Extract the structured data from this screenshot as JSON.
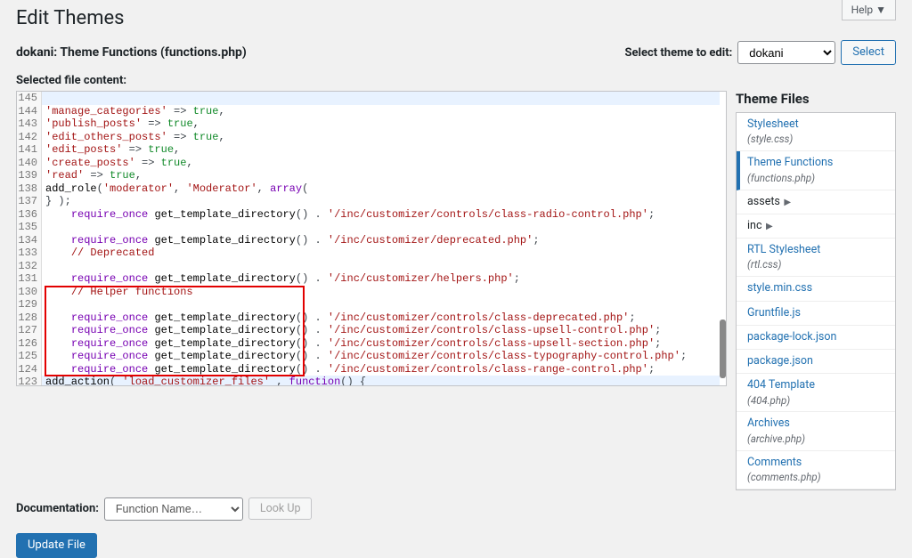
{
  "help_tab": "Help ▼",
  "page_title": "Edit Themes",
  "file_heading": "dokani: Theme Functions (functions.php)",
  "theme_select": {
    "label": "Select theme to edit:",
    "value": "dokani",
    "button": "Select"
  },
  "selected_file_label": "Selected file content:",
  "code_lines": [
    {
      "n": 123,
      "hl": true,
      "tokens": [
        [
          "id",
          "add_action"
        ],
        [
          "",
          "( "
        ],
        [
          "str",
          "'load_customizer_files'"
        ],
        [
          "",
          " , "
        ],
        [
          "kw",
          "function"
        ],
        [
          "",
          "() {"
        ]
      ]
    },
    {
      "n": 124,
      "hl": false,
      "tokens": [
        [
          "",
          "    "
        ],
        [
          "kw",
          "require_once"
        ],
        [
          "",
          " "
        ],
        [
          "id",
          "get_template_directory"
        ],
        [
          "",
          "() . "
        ],
        [
          "str",
          "'/inc/customizer/controls/class-range-control.php'"
        ],
        [
          "",
          ";"
        ]
      ]
    },
    {
      "n": 125,
      "hl": false,
      "tokens": [
        [
          "",
          "    "
        ],
        [
          "kw",
          "require_once"
        ],
        [
          "",
          " "
        ],
        [
          "id",
          "get_template_directory"
        ],
        [
          "",
          "() . "
        ],
        [
          "str",
          "'/inc/customizer/controls/class-typography-control.php'"
        ],
        [
          "",
          ";"
        ]
      ]
    },
    {
      "n": 126,
      "hl": false,
      "tokens": [
        [
          "",
          "    "
        ],
        [
          "kw",
          "require_once"
        ],
        [
          "",
          " "
        ],
        [
          "id",
          "get_template_directory"
        ],
        [
          "",
          "() . "
        ],
        [
          "str",
          "'/inc/customizer/controls/class-upsell-section.php'"
        ],
        [
          "",
          ";"
        ]
      ]
    },
    {
      "n": 127,
      "hl": false,
      "tokens": [
        [
          "",
          "    "
        ],
        [
          "kw",
          "require_once"
        ],
        [
          "",
          " "
        ],
        [
          "id",
          "get_template_directory"
        ],
        [
          "",
          "() . "
        ],
        [
          "str",
          "'/inc/customizer/controls/class-upsell-control.php'"
        ],
        [
          "",
          ";"
        ]
      ]
    },
    {
      "n": 128,
      "hl": false,
      "tokens": [
        [
          "",
          "    "
        ],
        [
          "kw",
          "require_once"
        ],
        [
          "",
          " "
        ],
        [
          "id",
          "get_template_directory"
        ],
        [
          "",
          "() . "
        ],
        [
          "str",
          "'/inc/customizer/controls/class-deprecated.php'"
        ],
        [
          "",
          ";"
        ]
      ]
    },
    {
      "n": 129,
      "hl": false,
      "tokens": [
        [
          "",
          ""
        ]
      ]
    },
    {
      "n": 130,
      "hl": false,
      "tokens": [
        [
          "",
          "    "
        ],
        [
          "str",
          "// Helper functions"
        ]
      ]
    },
    {
      "n": 131,
      "hl": false,
      "tokens": [
        [
          "",
          "    "
        ],
        [
          "kw",
          "require_once"
        ],
        [
          "",
          " "
        ],
        [
          "id",
          "get_template_directory"
        ],
        [
          "",
          "() . "
        ],
        [
          "str",
          "'/inc/customizer/helpers.php'"
        ],
        [
          "",
          ";"
        ]
      ]
    },
    {
      "n": 132,
      "hl": false,
      "tokens": [
        [
          "",
          ""
        ]
      ]
    },
    {
      "n": 133,
      "hl": false,
      "tokens": [
        [
          "",
          "    "
        ],
        [
          "str",
          "// Deprecated"
        ]
      ]
    },
    {
      "n": 134,
      "hl": false,
      "tokens": [
        [
          "",
          "    "
        ],
        [
          "kw",
          "require_once"
        ],
        [
          "",
          " "
        ],
        [
          "id",
          "get_template_directory"
        ],
        [
          "",
          "() . "
        ],
        [
          "str",
          "'/inc/customizer/deprecated.php'"
        ],
        [
          "",
          ";"
        ]
      ]
    },
    {
      "n": 135,
      "hl": false,
      "tokens": [
        [
          "",
          ""
        ]
      ]
    },
    {
      "n": 136,
      "hl": false,
      "tokens": [
        [
          "",
          "    "
        ],
        [
          "kw",
          "require_once"
        ],
        [
          "",
          " "
        ],
        [
          "id",
          "get_template_directory"
        ],
        [
          "",
          "() . "
        ],
        [
          "str",
          "'/inc/customizer/controls/class-radio-control.php'"
        ],
        [
          "",
          ";"
        ]
      ]
    },
    {
      "n": 137,
      "hl": false,
      "tokens": [
        [
          "",
          "} );"
        ]
      ]
    },
    {
      "n": 138,
      "hl": false,
      "tokens": [
        [
          "id",
          "add_role"
        ],
        [
          "",
          "("
        ],
        [
          "str",
          "'moderator'"
        ],
        [
          "",
          ", "
        ],
        [
          "str",
          "'Moderator'"
        ],
        [
          "",
          ", "
        ],
        [
          "kw",
          "array"
        ],
        [
          "",
          "("
        ]
      ]
    },
    {
      "n": 139,
      "hl": false,
      "tokens": [
        [
          "str",
          "'read'"
        ],
        [
          "",
          " => "
        ],
        [
          "bool",
          "true"
        ],
        [
          "",
          ","
        ]
      ]
    },
    {
      "n": 140,
      "hl": false,
      "tokens": [
        [
          "str",
          "'create_posts'"
        ],
        [
          "",
          " => "
        ],
        [
          "bool",
          "true"
        ],
        [
          "",
          ","
        ]
      ]
    },
    {
      "n": 141,
      "hl": false,
      "tokens": [
        [
          "str",
          "'edit_posts'"
        ],
        [
          "",
          " => "
        ],
        [
          "bool",
          "true"
        ],
        [
          "",
          ","
        ]
      ]
    },
    {
      "n": 142,
      "hl": false,
      "tokens": [
        [
          "str",
          "'edit_others_posts'"
        ],
        [
          "",
          " => "
        ],
        [
          "bool",
          "true"
        ],
        [
          "",
          ","
        ]
      ]
    },
    {
      "n": 143,
      "hl": false,
      "tokens": [
        [
          "str",
          "'publish_posts'"
        ],
        [
          "",
          " => "
        ],
        [
          "bool",
          "true"
        ],
        [
          "",
          ","
        ]
      ]
    },
    {
      "n": 144,
      "hl": false,
      "tokens": [
        [
          "str",
          "'manage_categories'"
        ],
        [
          "",
          " => "
        ],
        [
          "bool",
          "true"
        ],
        [
          "",
          ","
        ]
      ]
    },
    {
      "n": 145,
      "hl": true,
      "tokens": [
        [
          "",
          ""
        ]
      ]
    }
  ],
  "files_heading": "Theme Files",
  "file_tree": [
    {
      "label": "Stylesheet",
      "fname": "(style.css)",
      "active": false
    },
    {
      "label": "Theme Functions",
      "fname": "(functions.php)",
      "active": true
    },
    {
      "label": "assets",
      "folder": true
    },
    {
      "label": "inc",
      "folder": true
    },
    {
      "label": "RTL Stylesheet",
      "fname": "(rtl.css)"
    },
    {
      "label": "style.min.css"
    },
    {
      "label": "Gruntfile.js"
    },
    {
      "label": "package-lock.json"
    },
    {
      "label": "package.json"
    },
    {
      "label": "404 Template",
      "fname": "(404.php)"
    },
    {
      "label": "Archives",
      "fname": "(archive.php)"
    },
    {
      "label": "Comments",
      "fname": "(comments.php)"
    }
  ],
  "doc": {
    "label": "Documentation:",
    "placeholder": "Function Name…",
    "lookup": "Look Up"
  },
  "update_button": "Update File"
}
